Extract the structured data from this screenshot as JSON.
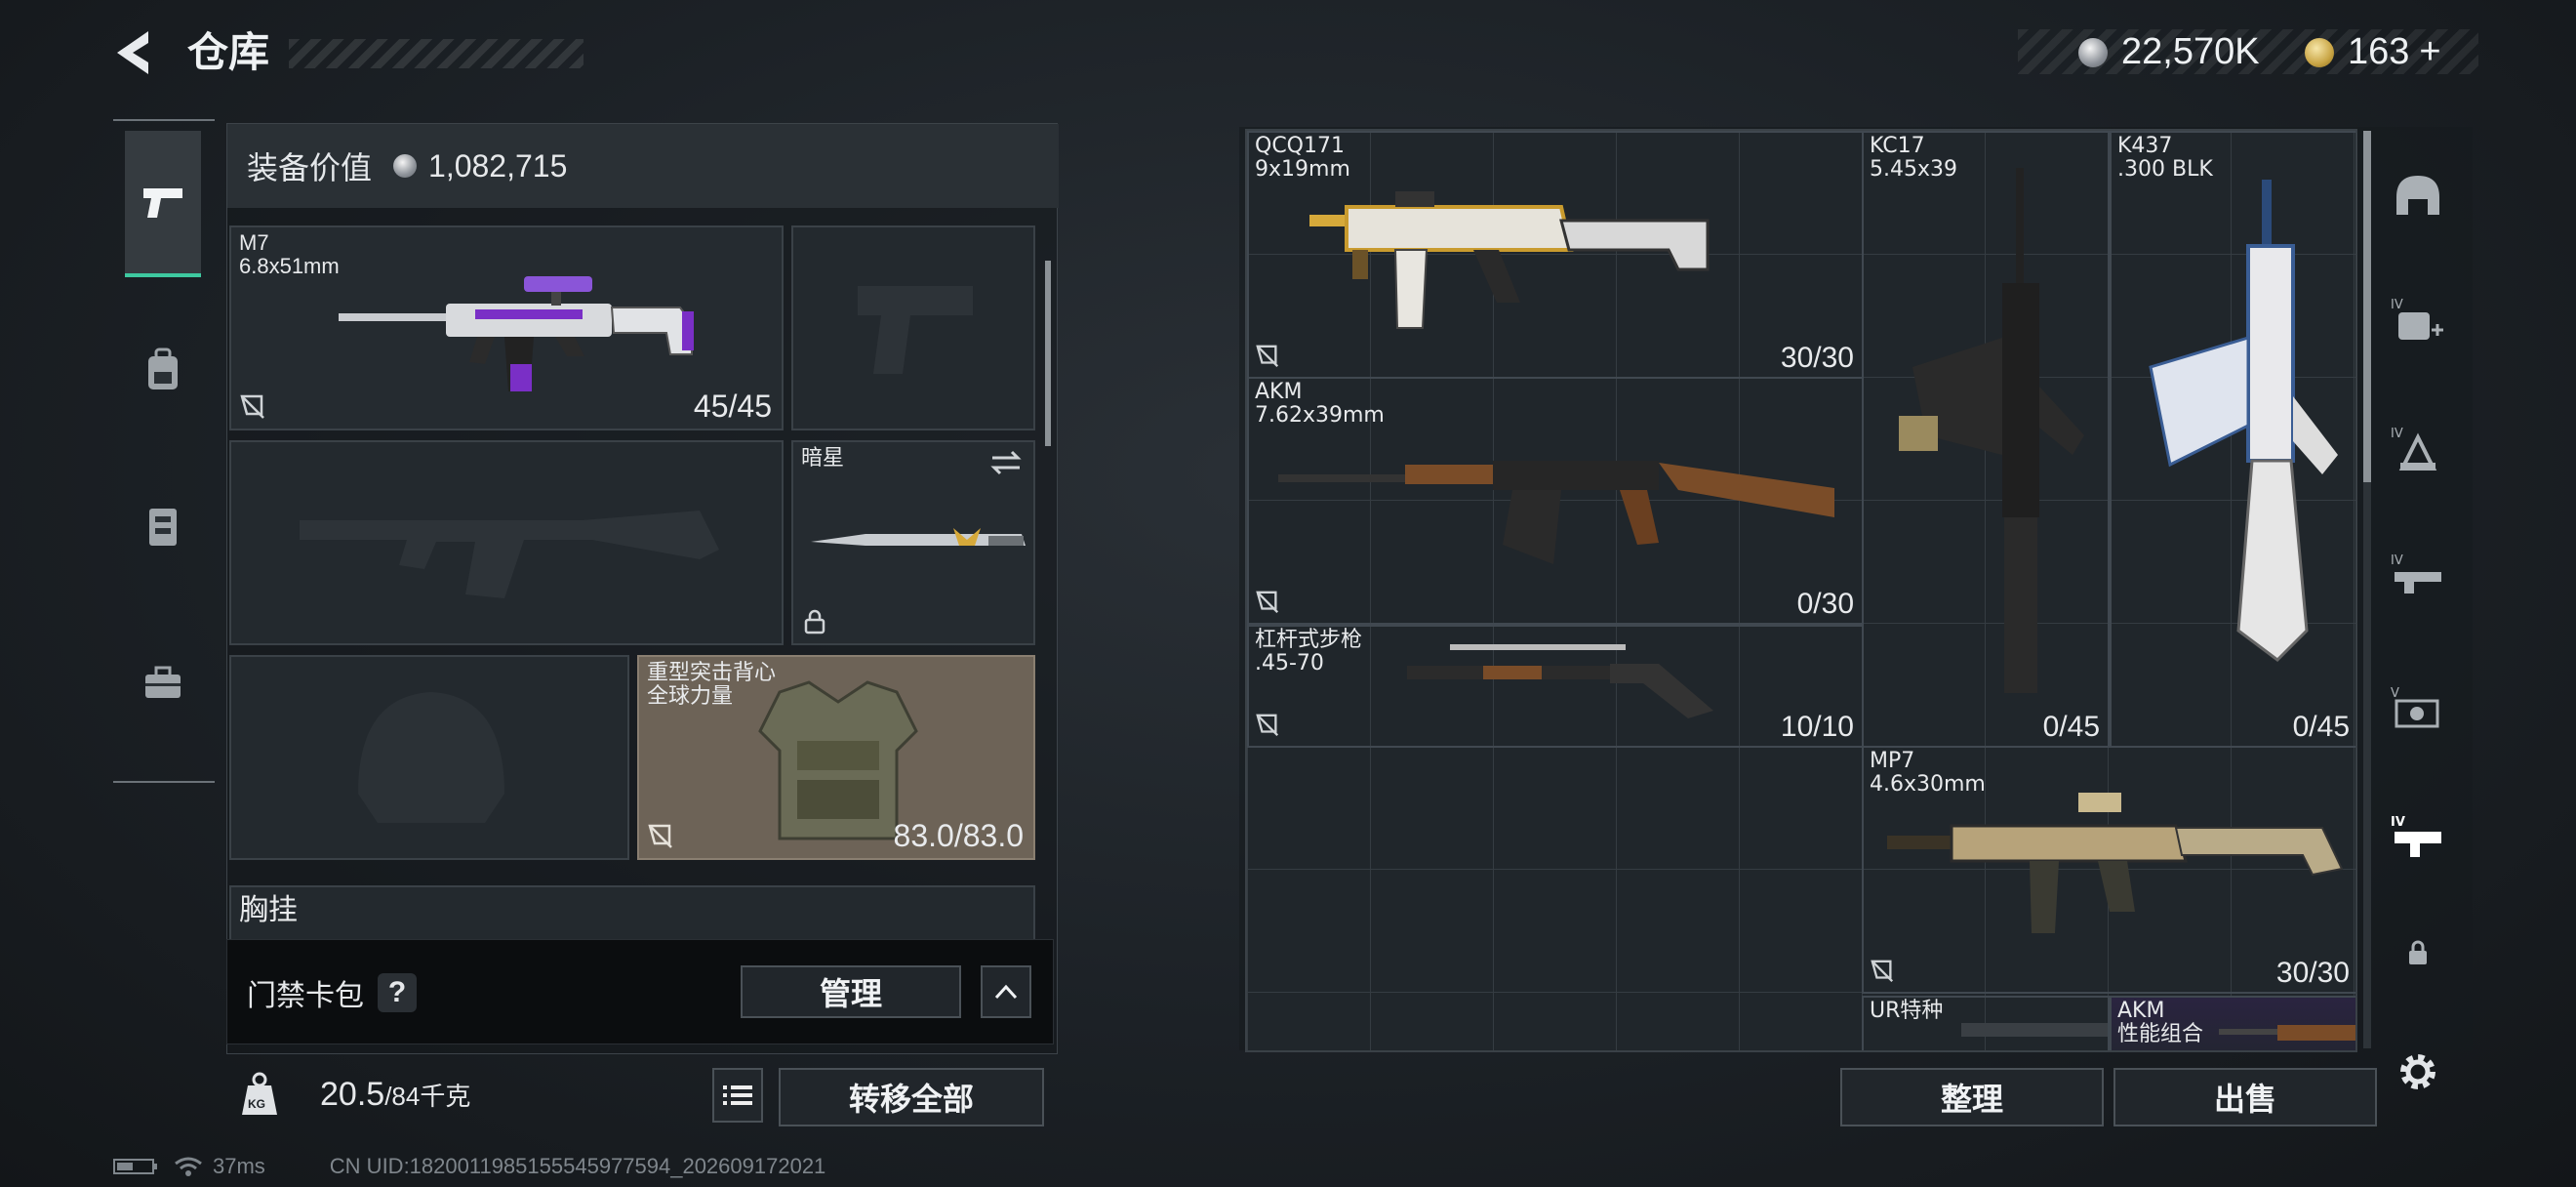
{
  "header": {
    "title": "仓库",
    "currencies": [
      {
        "icon": "silver-coin-icon",
        "value": "22,570K"
      },
      {
        "icon": "gold-coin-icon",
        "value": "163"
      }
    ],
    "add_label": "+"
  },
  "left_nav": [
    "pistol-icon",
    "backpack-icon",
    "vest-icon",
    "toolbox-icon"
  ],
  "loadout": {
    "value_label": "装备价值",
    "value": "1,082,715",
    "primary": {
      "name": "M7",
      "ammo": "6.8x51mm",
      "count": "45/45"
    },
    "melee": {
      "name": "暗星"
    },
    "armor": {
      "name": "重型突击背心",
      "subtitle": "全球力量",
      "count": "83.0/83.0"
    },
    "chest_rig_label": "胸挂"
  },
  "card_bar": {
    "label": "门禁卡包",
    "help": "?",
    "manage_label": "管理"
  },
  "weight": {
    "current": "20.5",
    "max": "/84千克",
    "kg_label": "KG"
  },
  "transfer_all_label": "转移全部",
  "stash": {
    "items": [
      {
        "name": "QCQ171",
        "ammo": "9x19mm",
        "count": "30/30"
      },
      {
        "name": "AKM",
        "ammo": "7.62x39mm",
        "count": "0/30"
      },
      {
        "name": "杠杆式步枪",
        "ammo": ".45-70",
        "count": "10/10"
      },
      {
        "name": "KC17",
        "ammo": "5.45x39",
        "count": "0/45"
      },
      {
        "name": "K437",
        "ammo": ".300 BLK",
        "count": "0/45"
      },
      {
        "name": "MP7",
        "ammo": "4.6x30mm",
        "count": "30/30"
      },
      {
        "name": "UR特种",
        "ammo": ""
      },
      {
        "name": "AKM",
        "ammo": "性能组合"
      }
    ],
    "sort_label": "整理",
    "sell_label": "出售"
  },
  "right_nav": [
    "helmet-icon",
    "add-backpack-icon",
    "tier4-vest-icon",
    "tier4-rifle-icon",
    "tier5-shotgun-icon",
    "tier4-smg-icon",
    "lock-icon",
    "settings-icon"
  ],
  "status": {
    "ping": "37ms",
    "uid": "CN UID:18200119851555459775​94_202609172021"
  }
}
